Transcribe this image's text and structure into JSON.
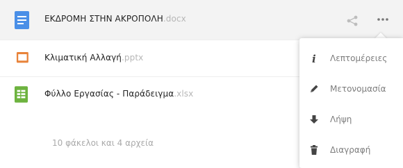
{
  "files": [
    {
      "name": "ΕΚΔΡΟΜΗ ΣΤΗΝ ΑΚΡΟΠΟΛΗ",
      "ext": ".docx",
      "type_icon": "document-icon",
      "color": "#4a8fe7"
    },
    {
      "name": "Κλιματική Αλλαγή",
      "ext": ".pptx",
      "type_icon": "presentation-icon",
      "color": "#e8833a"
    },
    {
      "name": "Φύλλο Εργασίας - Παράδειγμα",
      "ext": ".xlsx",
      "type_icon": "spreadsheet-icon",
      "color": "#6db33f"
    }
  ],
  "summary": "10 φάκελοι και 4 αρχεία",
  "menu": {
    "items": [
      {
        "label": "Λεπτομέρειες",
        "icon": "info-icon"
      },
      {
        "label": "Μετονομασία",
        "icon": "pencil-icon"
      },
      {
        "label": "Λήψη",
        "icon": "download-icon"
      },
      {
        "label": "Διαγραφή",
        "icon": "trash-icon"
      }
    ]
  }
}
